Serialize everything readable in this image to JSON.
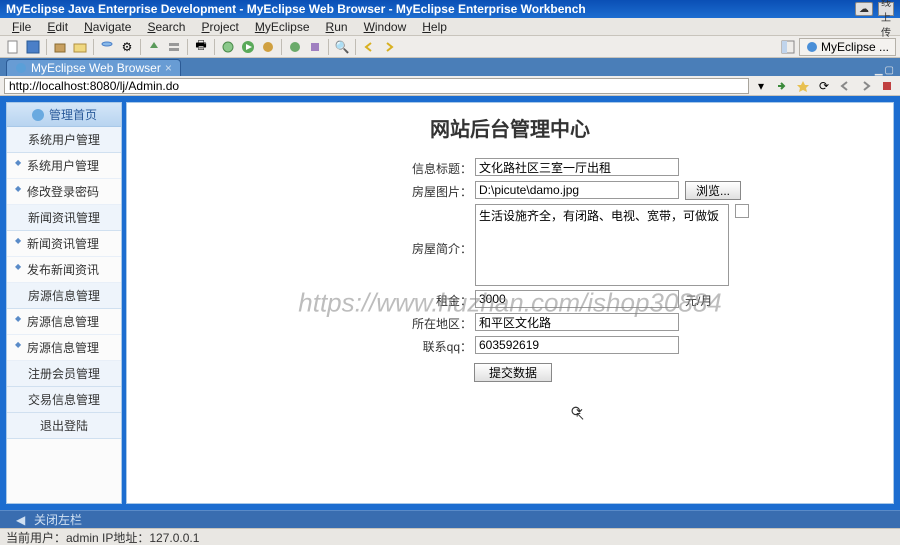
{
  "titlebar": {
    "text": "MyEclipse Java Enterprise Development - MyEclipse Web Browser - MyEclipse Enterprise Workbench",
    "cloud_label": "☁",
    "tag_label": "在线上传"
  },
  "menubar": [
    "File",
    "Edit",
    "Navigate",
    "Search",
    "Project",
    "MyEclipse",
    "Run",
    "Window",
    "Help"
  ],
  "tab": {
    "label": "MyEclipse Web Browser"
  },
  "addressbar": {
    "url": "http://localhost:8080/lj/Admin.do"
  },
  "toolbar_right": {
    "myeclipse_label": "MyEclipse ..."
  },
  "sidebar": {
    "header": "管理首页",
    "groups": [
      {
        "title": "系统用户管理",
        "items": [
          "系统用户管理",
          "修改登录密码"
        ]
      },
      {
        "title": "新闻资讯管理",
        "items": [
          "新闻资讯管理",
          "发布新闻资讯"
        ]
      },
      {
        "title": "房源信息管理",
        "items": [
          "房源信息管理",
          "房源信息管理"
        ]
      },
      {
        "title": "注册会员管理",
        "items": []
      },
      {
        "title": "交易信息管理",
        "items": []
      },
      {
        "title": "退出登陆",
        "items": []
      }
    ]
  },
  "page": {
    "title": "网站后台管理中心",
    "fields": {
      "info_title_label": "信息标题：",
      "info_title_value": "文化路社区三室一厅出租",
      "photo_label": "房屋图片：",
      "photo_value": "D:\\picute\\damo.jpg",
      "browse_btn": "浏览...",
      "intro_label": "房屋简介：",
      "intro_value": "生活设施齐全，有闭路、电视、宽带，可做饭",
      "rent_label": "租金：",
      "rent_value": "3000",
      "rent_unit": "元/月",
      "area_label": "所在地区：",
      "area_value": "和平区文化路",
      "qq_label": "联系qq：",
      "qq_value": "603592619",
      "submit_btn": "提交数据"
    }
  },
  "watermark": "https://www.huzhan.com/ishop30884",
  "collapse_bar": "关闭左栏",
  "status": "当前用户：admin  IP地址：127.0.0.1"
}
